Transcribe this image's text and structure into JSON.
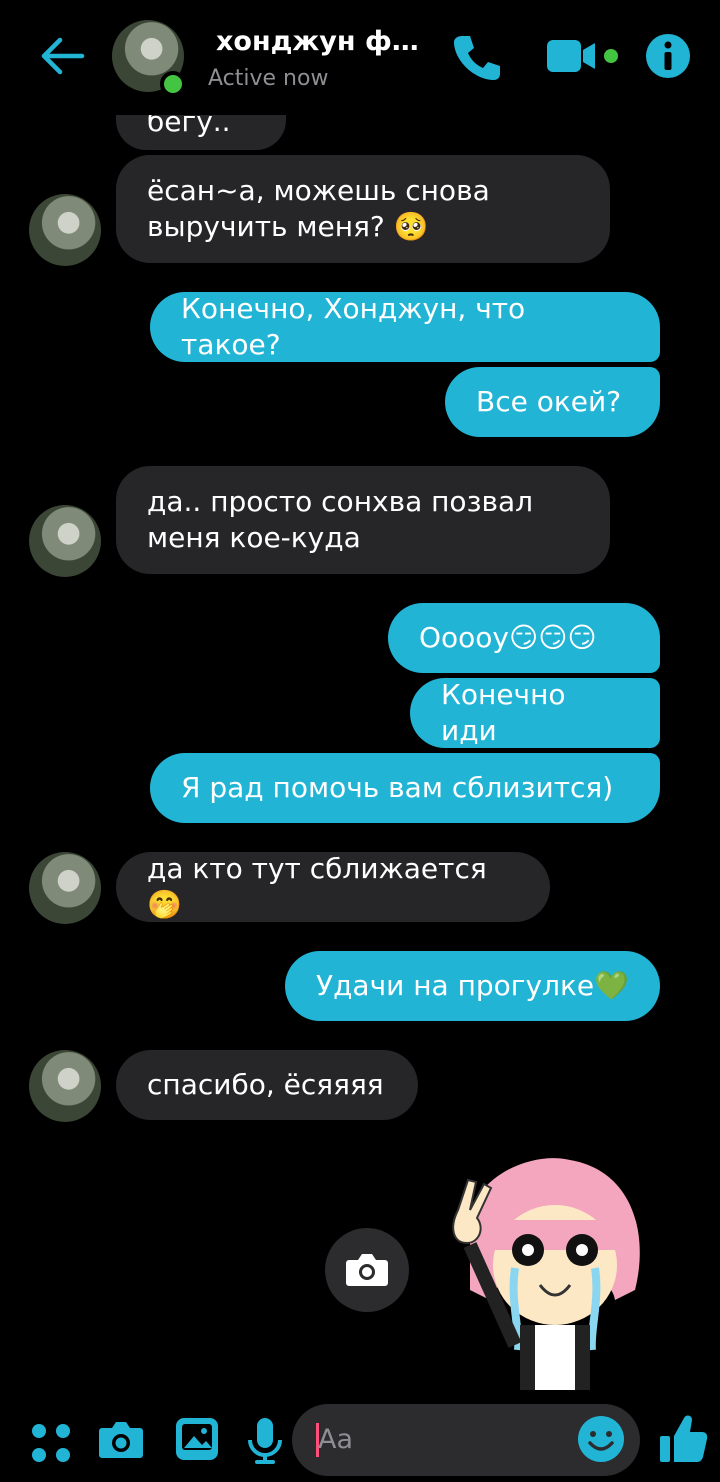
{
  "header": {
    "name": "хонджун фл...",
    "status": "Active now",
    "accent": "#21b4d5",
    "online_color": "#43c443"
  },
  "messages": [
    {
      "dir": "in",
      "text": "бегу.."
    },
    {
      "dir": "in",
      "text": "ёсан~а, можешь снова\nвыручить меня? 🥺"
    },
    {
      "dir": "out",
      "text": "Конечно, Хонджун, что такое?"
    },
    {
      "dir": "out",
      "text": "Все окей?"
    },
    {
      "dir": "in",
      "text": "да.. просто сонхва позвал\nменя кое-куда"
    },
    {
      "dir": "out",
      "text": "Ооооу😏😏😏"
    },
    {
      "dir": "out",
      "text": "Конечно иди"
    },
    {
      "dir": "out",
      "text": "Я рад помочь вам сблизится)"
    },
    {
      "dir": "in",
      "text": "да кто тут сближается🤭"
    },
    {
      "dir": "out",
      "text": "Удачи на прогулке💚"
    },
    {
      "dir": "in",
      "text": "спасибо, ёсяяяя"
    }
  ],
  "composer": {
    "placeholder": "Aa"
  },
  "icons": [
    "back-arrow-icon",
    "phone-icon",
    "video-icon",
    "info-icon",
    "camera-icon",
    "menu-dots-icon",
    "gallery-icon",
    "microphone-icon",
    "emoji-icon",
    "thumbs-up-icon"
  ]
}
